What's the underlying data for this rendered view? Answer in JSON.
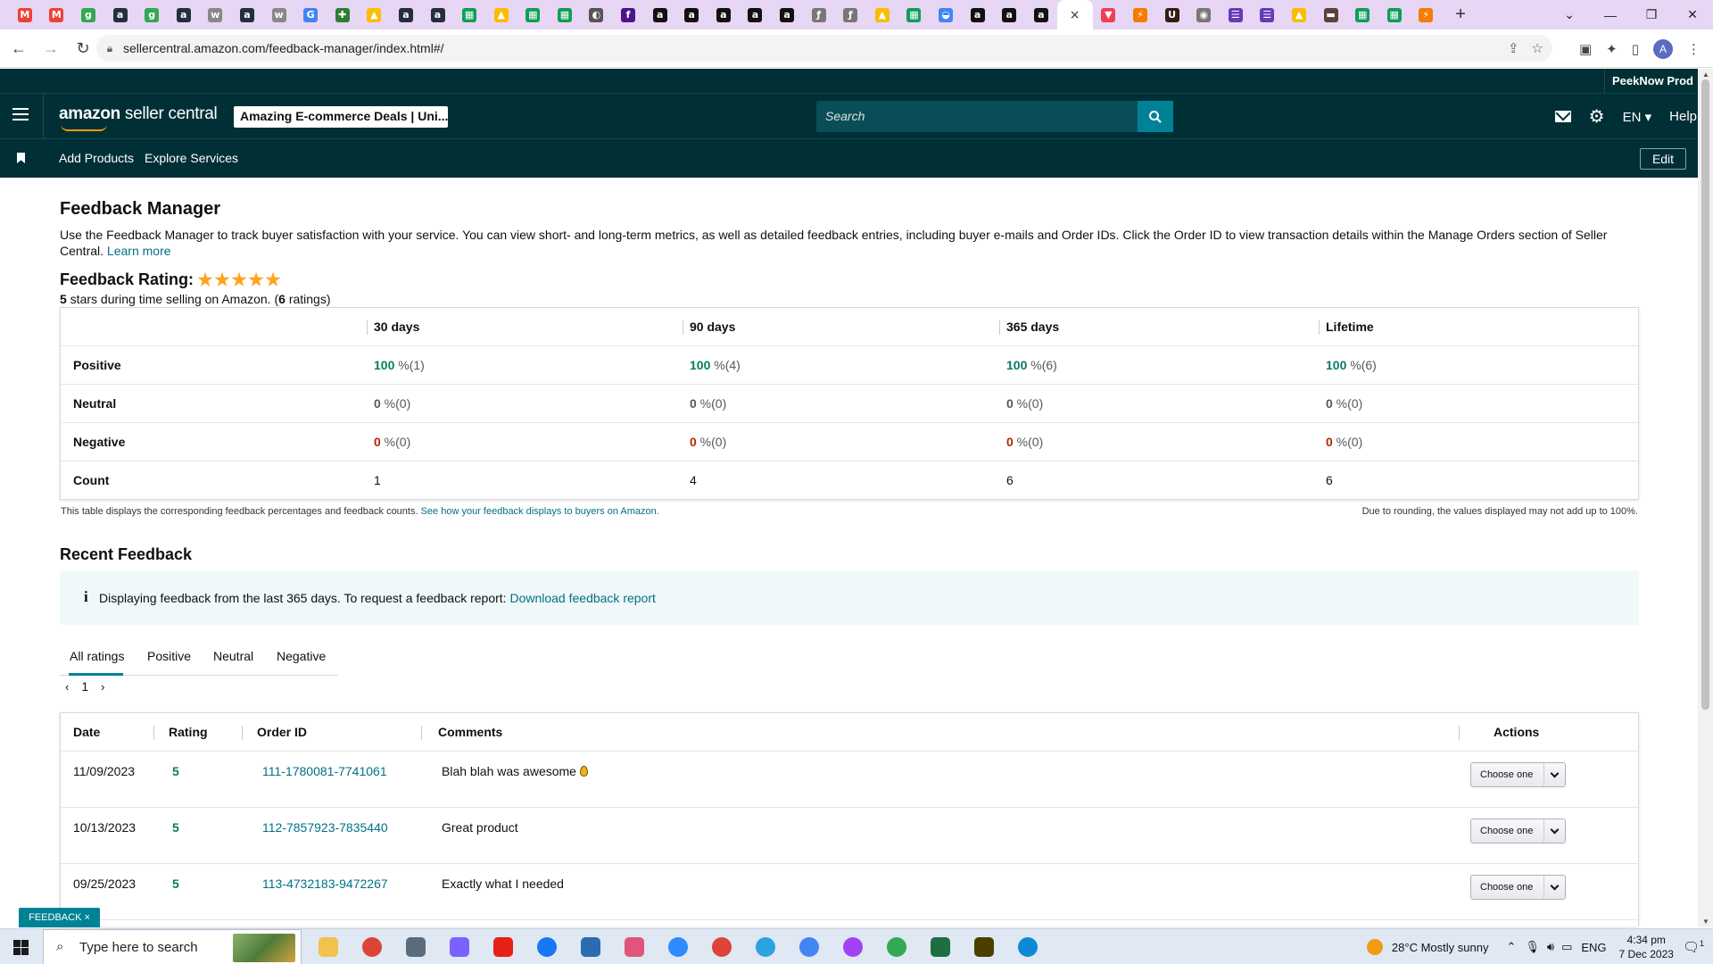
{
  "browser": {
    "tab_favicons": [
      {
        "icon": "gmail-icon",
        "glyph": "M",
        "color": "#ea4335"
      },
      {
        "icon": "gmail-icon",
        "glyph": "M",
        "color": "#ea4335"
      },
      {
        "icon": "google-icon",
        "glyph": "g",
        "color": "#34a853"
      },
      {
        "icon": "amazon-icon",
        "glyph": "a",
        "color": "#232f3e"
      },
      {
        "icon": "google-icon",
        "glyph": "g",
        "color": "#34a853"
      },
      {
        "icon": "amazon-icon",
        "glyph": "a",
        "color": "#232f3e"
      },
      {
        "icon": "wix-icon",
        "glyph": "w",
        "color": "#888888"
      },
      {
        "icon": "amazon-icon",
        "glyph": "a",
        "color": "#232f3e"
      },
      {
        "icon": "wix-icon",
        "glyph": "w",
        "color": "#888888"
      },
      {
        "icon": "google-icon",
        "glyph": "G",
        "color": "#4285f4"
      },
      {
        "icon": "puzzle-icon",
        "glyph": "✚",
        "color": "#2e7d32"
      },
      {
        "icon": "drive-icon",
        "glyph": "▲",
        "color": "#fbbc04"
      },
      {
        "icon": "amazon-icon",
        "glyph": "a",
        "color": "#232f3e"
      },
      {
        "icon": "amazon-icon",
        "glyph": "a",
        "color": "#232f3e"
      },
      {
        "icon": "sheets-icon",
        "glyph": "▦",
        "color": "#0f9d58"
      },
      {
        "icon": "drive-icon",
        "glyph": "▲",
        "color": "#fbbc04"
      },
      {
        "icon": "sheets-icon",
        "glyph": "▦",
        "color": "#0f9d58"
      },
      {
        "icon": "sheets-icon",
        "glyph": "▦",
        "color": "#0f9d58"
      },
      {
        "icon": "globe-icon",
        "glyph": "◐",
        "color": "#555555"
      },
      {
        "icon": "fedex-icon",
        "glyph": "f",
        "color": "#4d148c"
      },
      {
        "icon": "amazon-icon",
        "glyph": "a",
        "color": "#111111"
      },
      {
        "icon": "amazon-icon",
        "glyph": "a",
        "color": "#111111"
      },
      {
        "icon": "amazon-icon",
        "glyph": "a",
        "color": "#111111"
      },
      {
        "icon": "amazon-icon",
        "glyph": "a",
        "color": "#111111"
      },
      {
        "icon": "amazon-icon",
        "glyph": "a",
        "color": "#111111"
      },
      {
        "icon": "script-icon",
        "glyph": "ƒ",
        "color": "#777777"
      },
      {
        "icon": "script-icon",
        "glyph": "ƒ",
        "color": "#777777"
      },
      {
        "icon": "drive-icon",
        "glyph": "▲",
        "color": "#fbbc04"
      },
      {
        "icon": "sheets-icon",
        "glyph": "▦",
        "color": "#0f9d58"
      },
      {
        "icon": "drive-icon",
        "glyph": "◒",
        "color": "#4285f4"
      },
      {
        "icon": "amazon-icon",
        "glyph": "a",
        "color": "#111111"
      },
      {
        "icon": "amazon-icon",
        "glyph": "a",
        "color": "#111111"
      },
      {
        "icon": "amazon-icon",
        "glyph": "a",
        "color": "#111111"
      }
    ],
    "active_tab_close": "×",
    "tabs_after_active": [
      {
        "icon": "pocket-icon",
        "glyph": "▼",
        "color": "#ef3f56"
      },
      {
        "icon": "tool-icon",
        "glyph": "⚡",
        "color": "#f57c00"
      },
      {
        "icon": "ups-icon",
        "glyph": "U",
        "color": "#351c15"
      },
      {
        "icon": "globe-icon",
        "glyph": "◉",
        "color": "#777777"
      },
      {
        "icon": "forms-icon",
        "glyph": "☰",
        "color": "#673ab7"
      },
      {
        "icon": "forms-icon",
        "glyph": "☰",
        "color": "#673ab7"
      },
      {
        "icon": "drive-icon",
        "glyph": "▲",
        "color": "#fbbc04"
      },
      {
        "icon": "ups-icon",
        "glyph": "▬",
        "color": "#5d4037"
      },
      {
        "icon": "sheets-icon",
        "glyph": "▦",
        "color": "#0f9d58"
      },
      {
        "icon": "sheets-icon",
        "glyph": "▦",
        "color": "#0f9d58"
      },
      {
        "icon": "tool-icon",
        "glyph": "⚡",
        "color": "#f57c00"
      }
    ],
    "url": "sellercentral.amazon.com/feedback-manager/index.html#/",
    "profile_initial": "A"
  },
  "header": {
    "account_name": "PeekNow Prod",
    "logo_brand": "amazon",
    "logo_suffix": " seller central",
    "store_selector": "Amazing E-commerce Deals | Uni...",
    "search_placeholder": "Search",
    "language": "EN",
    "help": "Help",
    "nav_items": [
      "Add Products",
      "Explore Services"
    ],
    "edit_label": "Edit"
  },
  "page": {
    "title": "Feedback Manager",
    "intro": "Use the Feedback Manager to track buyer satisfaction with your service. You can view short- and long-term metrics, as well as detailed feedback entries, including buyer e-mails and Order IDs. Click the Order ID to view transaction details within the Manage Orders section of Seller Central.",
    "learn_more": "Learn more",
    "rating_label": "Feedback Rating:",
    "rating_stars": 5,
    "rating_sub_value": "5",
    "rating_sub_text": " stars during time selling on Amazon. (",
    "rating_sub_count": "6",
    "rating_sub_end": " ratings)"
  },
  "metrics_table": {
    "columns": [
      "",
      "30 days",
      "90 days",
      "365 days",
      "Lifetime"
    ],
    "rows": [
      {
        "label": "Positive",
        "kind": "pos",
        "cells": [
          {
            "v": "100",
            "u": " %(1)"
          },
          {
            "v": "100",
            "u": " %(4)"
          },
          {
            "v": "100",
            "u": " %(6)"
          },
          {
            "v": "100",
            "u": " %(6)"
          }
        ]
      },
      {
        "label": "Neutral",
        "kind": "neu",
        "cells": [
          {
            "v": "0",
            "u": " %(0)"
          },
          {
            "v": "0",
            "u": " %(0)"
          },
          {
            "v": "0",
            "u": " %(0)"
          },
          {
            "v": "0",
            "u": " %(0)"
          }
        ]
      },
      {
        "label": "Negative",
        "kind": "neg",
        "cells": [
          {
            "v": "0",
            "u": " %(0)"
          },
          {
            "v": "0",
            "u": " %(0)"
          },
          {
            "v": "0",
            "u": " %(0)"
          },
          {
            "v": "0",
            "u": " %(0)"
          }
        ]
      },
      {
        "label": "Count",
        "kind": "plain",
        "cells": [
          {
            "v": "1",
            "u": ""
          },
          {
            "v": "4",
            "u": ""
          },
          {
            "v": "6",
            "u": ""
          },
          {
            "v": "6",
            "u": ""
          }
        ]
      }
    ],
    "note_left": "This table displays the corresponding feedback percentages and feedback counts. ",
    "note_link": "See how your feedback displays to buyers on Amazon.",
    "note_right": "Due to rounding, the values displayed may not add up to 100%."
  },
  "recent": {
    "title": "Recent Feedback",
    "alert_icon": "i",
    "alert_text": "Displaying feedback from the last 365 days. To request a feedback report: ",
    "alert_link": "Download feedback report",
    "tabs": [
      "All ratings",
      "Positive",
      "Neutral",
      "Negative"
    ],
    "active_tab": "All ratings",
    "page_prev": "‹",
    "page_current": "1",
    "page_next": "›",
    "columns": [
      "Date",
      "Rating",
      "Order ID",
      "Comments",
      "Actions"
    ],
    "rows": [
      {
        "date": "11/09/2023",
        "rating": "5",
        "order_id": "111-1780081-7741061",
        "comment": "Blah blah was awesome",
        "emoji": "droplet-emoji",
        "action": "Choose one"
      },
      {
        "date": "10/13/2023",
        "rating": "5",
        "order_id": "112-7857923-7835440",
        "comment": "Great product",
        "action": "Choose one"
      },
      {
        "date": "09/25/2023",
        "rating": "5",
        "order_id": "113-4732183-9472267",
        "comment": "Exactly what I needed",
        "action": "Choose one"
      }
    ]
  },
  "feedback_widget": "FEEDBACK ×",
  "taskbar": {
    "search_placeholder": "Type here to search",
    "apps": [
      {
        "icon": "file-explorer-icon",
        "color": "#f2c14e"
      },
      {
        "icon": "chrome-icon",
        "color": "#db4437"
      },
      {
        "icon": "calculator-icon",
        "color": "#5a6b7c"
      },
      {
        "icon": "copilot-icon",
        "color": "#7b61ff"
      },
      {
        "icon": "youtube-icon",
        "color": "#e62117"
      },
      {
        "icon": "facebook-icon",
        "color": "#1877f2"
      },
      {
        "icon": "store-icon",
        "color": "#2b6cb0"
      },
      {
        "icon": "snipping-icon",
        "color": "#e2557a"
      },
      {
        "icon": "zoom-icon",
        "color": "#2d8cff"
      },
      {
        "icon": "chrome-icon",
        "color": "#db4437"
      },
      {
        "icon": "telegram-icon",
        "color": "#2aa3df"
      },
      {
        "icon": "chrome-icon",
        "color": "#4285f4"
      },
      {
        "icon": "chrome-icon",
        "color": "#a142f4"
      },
      {
        "icon": "chrome-icon",
        "color": "#34a853"
      },
      {
        "icon": "excel-icon",
        "color": "#1d6f42"
      },
      {
        "icon": "sticky-notes-icon",
        "color": "#4a3f00"
      },
      {
        "icon": "edge-icon",
        "color": "#0c8ad8"
      }
    ],
    "weather": "28°C  Mostly sunny",
    "lang": "ENG",
    "time": "4:34 pm",
    "date": "7 Dec 2023",
    "notification_count": "1"
  }
}
